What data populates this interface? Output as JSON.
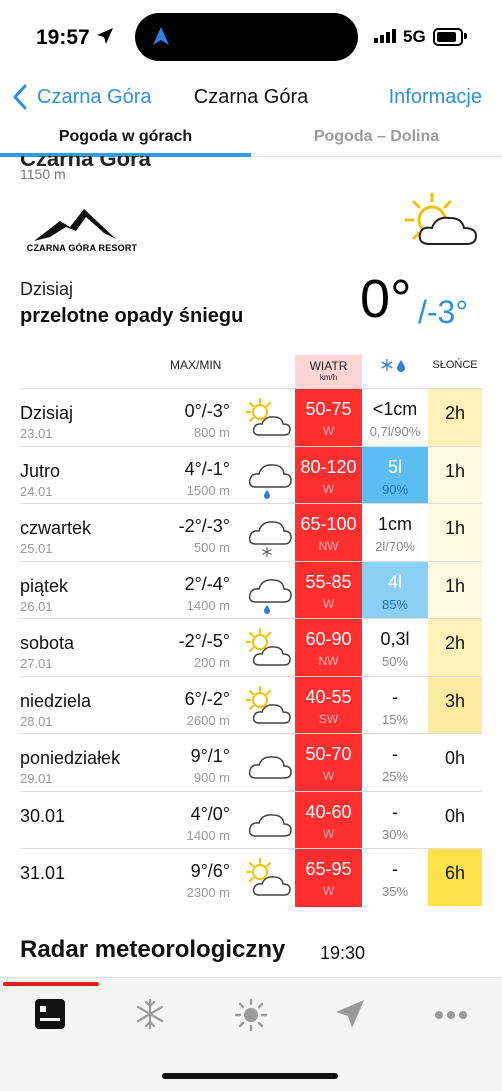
{
  "status_bar": {
    "time": "19:57",
    "network": "5G"
  },
  "nav": {
    "back_label": "Czarna Góra",
    "title": "Czarna Góra",
    "info_label": "Informacje"
  },
  "tabs": [
    {
      "label": "Pogoda w górach",
      "active": true
    },
    {
      "label": "Pogoda – Dolina",
      "active": false
    }
  ],
  "header": {
    "partial_title": "Czarna Góra",
    "elevation": "1150 m",
    "logo_text": "CZARNA GÓRA RESORT",
    "today_label": "Dzisiaj",
    "description": "przelotne opady śniegu",
    "temp_max": "0°",
    "temp_min": "/-3°"
  },
  "table": {
    "headers": {
      "maxmin": "MAX/MIN",
      "wind": "WIATR",
      "wind_unit": "km/h",
      "sun": "SŁOŃCE"
    },
    "rows": [
      {
        "day": "Dzisiaj",
        "date": "23.01",
        "temp": "0°/-3°",
        "alt": "800 m",
        "icon": "sun-cloud-icon",
        "wind": "50-75",
        "dir": "W",
        "prec": "<1cm",
        "pdet": "0,7l/90%",
        "prec_color": "#ffffff",
        "sun": "2h",
        "sun_color": "#fdf0b8"
      },
      {
        "day": "Jutro",
        "date": "24.01",
        "temp": "4°/-1°",
        "alt": "1500 m",
        "icon": "cloud-rain-icon",
        "wind": "80-120",
        "dir": "W",
        "prec": "5l",
        "pdet": "90%",
        "prec_color": "#5bbdf2",
        "sun": "1h",
        "sun_color": "#fff9df"
      },
      {
        "day": "czwartek",
        "date": "25.01",
        "temp": "-2°/-3°",
        "alt": "500 m",
        "icon": "cloud-snow-icon",
        "wind": "65-100",
        "dir": "NW",
        "prec": "1cm",
        "pdet": "2l/70%",
        "prec_color": "#ffffff",
        "sun": "1h",
        "sun_color": "#fff9df"
      },
      {
        "day": "piątek",
        "date": "26.01",
        "temp": "2°/-4°",
        "alt": "1400 m",
        "icon": "cloud-rain-icon",
        "wind": "55-85",
        "dir": "W",
        "prec": "4l",
        "pdet": "85%",
        "prec_color": "#8ccff5",
        "sun": "1h",
        "sun_color": "#fff9df"
      },
      {
        "day": "sobota",
        "date": "27.01",
        "temp": "-2°/-5°",
        "alt": "200 m",
        "icon": "sun-cloud-icon",
        "wind": "60-90",
        "dir": "NW",
        "prec": "0,3l",
        "pdet": "50%",
        "prec_color": "#ffffff",
        "sun": "2h",
        "sun_color": "#fdf0b8"
      },
      {
        "day": "niedziela",
        "date": "28.01",
        "temp": "6°/-2°",
        "alt": "2600 m",
        "icon": "sun-cloud-icon",
        "wind": "40-55",
        "dir": "SW",
        "prec": "-",
        "pdet": "15%",
        "prec_color": "#ffffff",
        "sun": "3h",
        "sun_color": "#fdeba0"
      },
      {
        "day": "poniedziałek",
        "date": "29.01",
        "temp": "9°/1°",
        "alt": "900 m",
        "icon": "cloud-icon",
        "wind": "50-70",
        "dir": "W",
        "prec": "-",
        "pdet": "25%",
        "prec_color": "#ffffff",
        "sun": "0h",
        "sun_color": "#ffffff"
      },
      {
        "day": "30.01",
        "date": "",
        "temp": "4°/0°",
        "alt": "1400 m",
        "icon": "cloud-icon",
        "wind": "40-60",
        "dir": "W",
        "prec": "-",
        "pdet": "30%",
        "prec_color": "#ffffff",
        "sun": "0h",
        "sun_color": "#ffffff"
      },
      {
        "day": "31.01",
        "date": "",
        "temp": "9°/6°",
        "alt": "2300 m",
        "icon": "sun-cloud-icon",
        "wind": "65-95",
        "dir": "W",
        "prec": "-",
        "pdet": "35%",
        "prec_color": "#ffffff",
        "sun": "6h",
        "sun_color": "#fde24a"
      }
    ]
  },
  "radar": {
    "title": "Radar meteorologiczny",
    "time": "19:30"
  },
  "tabbar": {
    "items": [
      {
        "icon": "forecast-icon",
        "active": true
      },
      {
        "icon": "snowflake-icon",
        "active": false
      },
      {
        "icon": "sun-icon",
        "active": false
      },
      {
        "icon": "navigation-icon",
        "active": false
      },
      {
        "icon": "more-icon",
        "active": false
      }
    ]
  },
  "colors": {
    "accent": "#2f8fe0",
    "wind": "#ff2f2f",
    "tab_active": "#e02020"
  }
}
